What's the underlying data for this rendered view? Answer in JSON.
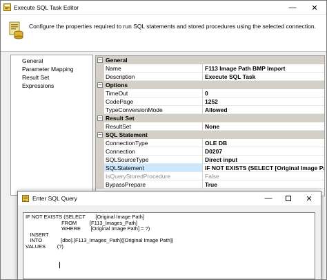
{
  "main_window": {
    "title": "Execute SQL Task Editor",
    "header_text": "Configure the properties required to run SQL statements and stored procedures using the selected connection."
  },
  "nav": {
    "items": [
      "General",
      "Parameter Mapping",
      "Result Set",
      "Expressions"
    ]
  },
  "property_grid": {
    "categories": [
      {
        "name": "General",
        "props": [
          {
            "name": "Name",
            "value": "F113 Image Path BMP Import"
          },
          {
            "name": "Description",
            "value": "Execute SQL Task"
          }
        ]
      },
      {
        "name": "Options",
        "props": [
          {
            "name": "TimeOut",
            "value": "0"
          },
          {
            "name": "CodePage",
            "value": "1252"
          },
          {
            "name": "TypeConversionMode",
            "value": "Allowed"
          }
        ]
      },
      {
        "name": "Result Set",
        "props": [
          {
            "name": "ResultSet",
            "value": "None"
          }
        ]
      },
      {
        "name": "SQL Statement",
        "props": [
          {
            "name": "ConnectionType",
            "value": "OLE DB"
          },
          {
            "name": "Connection",
            "value": "D0207"
          },
          {
            "name": "SQLSourceType",
            "value": "Direct input"
          },
          {
            "name": "SQLStatement",
            "value": "IF NOT EXISTS (SELECT      [Original Image Path]"
          },
          {
            "name": "IsQueryStoredProcedure",
            "value": "False"
          },
          {
            "name": "BypassPrepare",
            "value": "True"
          }
        ]
      }
    ],
    "toggle_glyph": "−"
  },
  "dialog": {
    "title": "Enter SQL Query",
    "sql_text": "IF NOT EXISTS (SELECT       [Original Image Path]\n                         FROM         [F113_Images_Path]\n                         WHERE       [Original Image Path] = ?)\n   INSERT\n   INTO             [dbo].[F113_Images_Path]([Original Image Path])\nVALUES        (?)"
  },
  "glyphs": {
    "minimize": "—",
    "close": "✕"
  },
  "colors": {
    "selected_row": "#cce8ff",
    "category_bg": "#d4d0c8",
    "window_bg": "#f0f0f0"
  }
}
